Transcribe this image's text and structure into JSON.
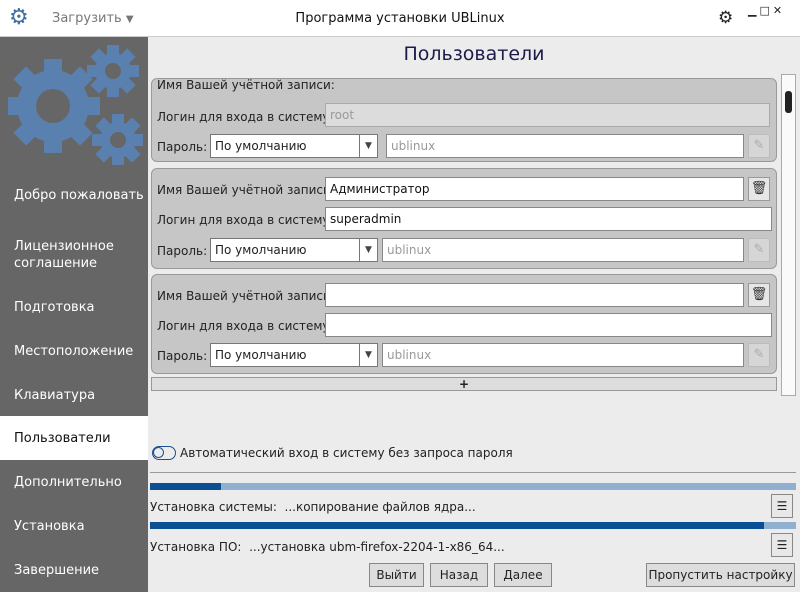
{
  "titlebar": {
    "load_label": "Загрузить",
    "title": "Программа установки UBLinux"
  },
  "sidebar": {
    "items": [
      "Добро пожаловать",
      "Лицензионное соглашение",
      "Подготовка",
      "Местоположение",
      "Клавиатура",
      "Пользователи",
      "Дополнительно",
      "Установка",
      "Завершение"
    ],
    "selected": 5
  },
  "main": {
    "title": "Пользователи"
  },
  "labels": {
    "account": "Имя Вашей учётной записи:",
    "login": "Логин для входа в систему:",
    "password": "Пароль:"
  },
  "users": [
    {
      "account": "",
      "login": "root",
      "password_mode": "По умолчанию",
      "password": "ublinux"
    },
    {
      "account": "Администратор",
      "login": "superadmin",
      "password_mode": "По умолчанию",
      "password": "ublinux"
    },
    {
      "account": "",
      "login": "",
      "password_mode": "По умолчанию",
      "password": "ublinux"
    }
  ],
  "add_label": "+",
  "autologin": {
    "label": "Автоматический вход в систему без запроса пароля",
    "enabled": false
  },
  "progress": [
    {
      "label": "Установка системы:",
      "status": "...копирование файлов ядра...",
      "percent": 11
    },
    {
      "label": "Установка ПО:",
      "status": "...установка ubm-firefox-2204-1-x86_64...",
      "percent": 95
    }
  ],
  "buttons": {
    "exit": "Выйти",
    "back": "Назад",
    "next": "Далее",
    "skip": "Пропустить настройку"
  },
  "colors": {
    "accent": "#0a4f94",
    "sidebar": "#666666",
    "logo": "#5a80b0"
  }
}
